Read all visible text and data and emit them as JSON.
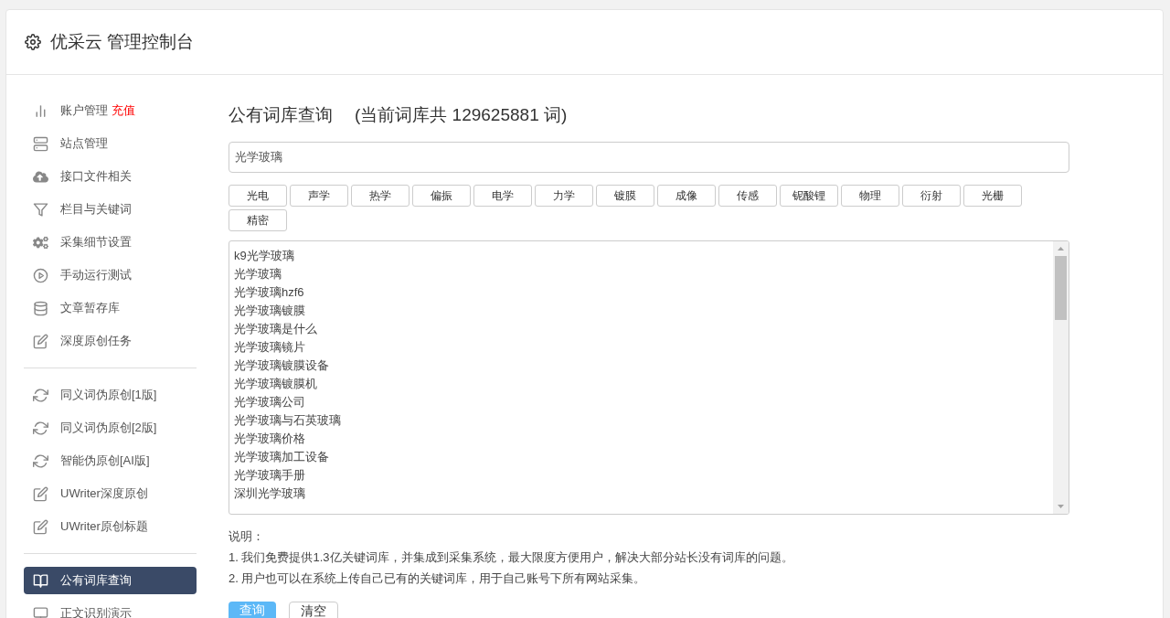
{
  "header": {
    "title": "优采云 管理控制台"
  },
  "sidebar": {
    "groups": [
      [
        {
          "label": "账户管理",
          "badge": "充值",
          "selected": false
        },
        {
          "label": "站点管理",
          "selected": false
        },
        {
          "label": "接口文件相关",
          "selected": false
        },
        {
          "label": "栏目与关键词",
          "selected": false
        },
        {
          "label": "采集细节设置",
          "selected": false
        },
        {
          "label": "手动运行测试",
          "selected": false
        },
        {
          "label": "文章暂存库",
          "selected": false
        },
        {
          "label": "深度原创任务",
          "selected": false
        }
      ],
      [
        {
          "label": "同义词伪原创[1版]",
          "selected": false
        },
        {
          "label": "同义词伪原创[2版]",
          "selected": false
        },
        {
          "label": "智能伪原创[AI版]",
          "selected": false
        },
        {
          "label": "UWriter深度原创",
          "selected": false
        },
        {
          "label": "UWriter原创标题",
          "selected": false
        }
      ],
      [
        {
          "label": "公有词库查询",
          "selected": true
        },
        {
          "label": "正文识别演示",
          "selected": false
        }
      ]
    ]
  },
  "main": {
    "title": "公有词库查询",
    "subtitle": "(当前词库共 129625881 词)",
    "search": {
      "value": "光学玻璃"
    },
    "tags": [
      "光电",
      "声学",
      "热学",
      "偏振",
      "电学",
      "力学",
      "镀膜",
      "成像",
      "传感",
      "铌酸锂",
      "物理",
      "衍射",
      "光栅",
      "精密"
    ],
    "results": [
      "k9光学玻璃",
      "光学玻璃",
      "光学玻璃hzf6",
      "光学玻璃镀膜",
      "光学玻璃是什么",
      "光学玻璃镜片",
      "光学玻璃镀膜设备",
      "光学玻璃镀膜机",
      "光学玻璃公司",
      "光学玻璃与石英玻璃",
      "光学玻璃价格",
      "光学玻璃加工设备",
      "光学玻璃手册",
      "深圳光学玻璃"
    ],
    "notes_title": "说明：",
    "notes": [
      "1. 我们免费提供1.3亿关键词库，并集成到采集系统，最大限度方便用户，解决大部分站长没有词库的问题。",
      "2. 用户也可以在系统上传自己已有的关键词库，用于自己账号下所有网站采集。"
    ],
    "buttons": [
      {
        "label": "查询",
        "kind": "primary"
      },
      {
        "label": "清空",
        "kind": "default"
      }
    ]
  }
}
